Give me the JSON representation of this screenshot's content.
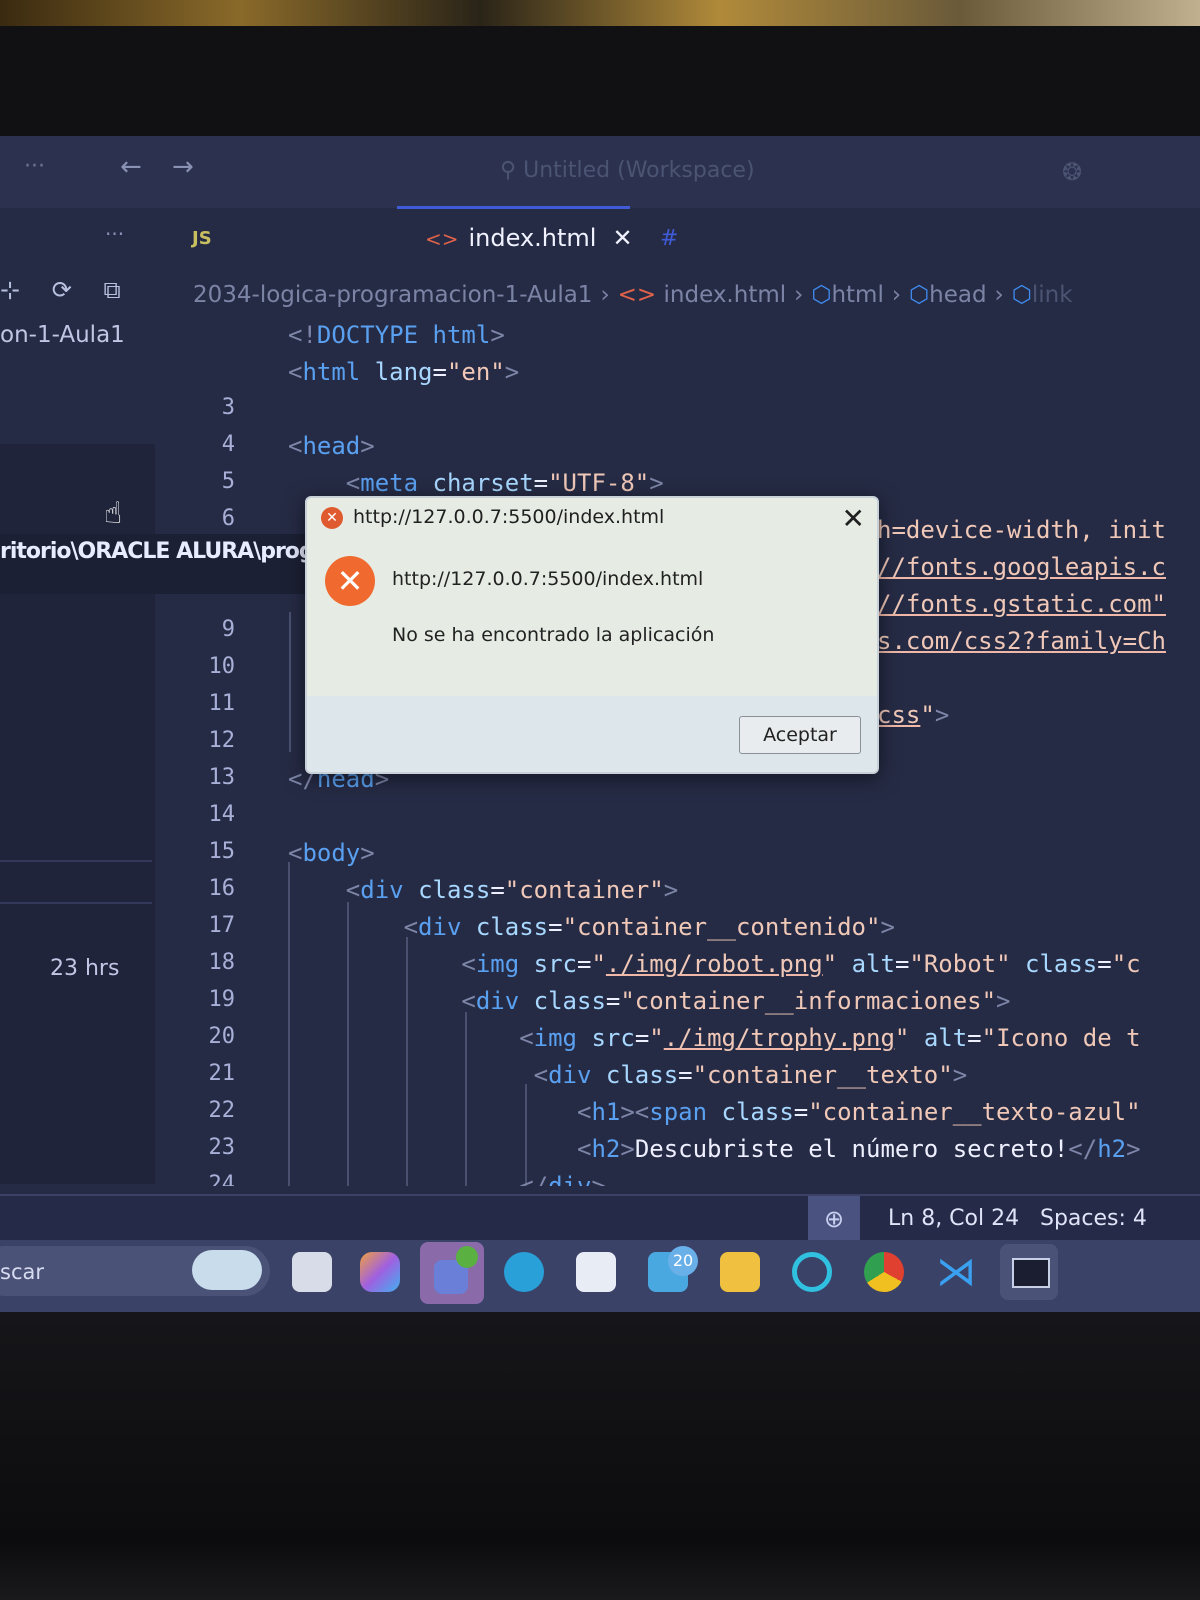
{
  "titlebar": {
    "menu": "···",
    "back": "←",
    "forward": "→",
    "search_icon": "search-icon",
    "search_text": "Untitled (Workspace)",
    "account_icon": "copilot-icon"
  },
  "tabs": {
    "overflow": "···",
    "js_icon": "JS",
    "active": {
      "icon": "<>",
      "label": "index.html",
      "close": "✕"
    },
    "css_icon": "#"
  },
  "sidebar": {
    "toolbar": "⊹ ⟳ ⧉",
    "folder": "on-1-Aula1",
    "hover_path": "ritorio\\ORACLE ALURA\\progra",
    "time": "23 hrs"
  },
  "breadcrumb": {
    "folder": "2034-logica-programacion-1-Aula1",
    "file": "index.html",
    "items": [
      "html",
      "head",
      "link"
    ]
  },
  "editor": {
    "lines": [
      {
        "n": "",
        "indent": 0,
        "tokens": [
          [
            "br",
            "<!"
          ],
          [
            "kw",
            "DOCTYPE"
          ],
          [
            "txt",
            " "
          ],
          [
            "tag",
            "html"
          ],
          [
            "br",
            ">"
          ]
        ]
      },
      {
        "n": "",
        "indent": 0,
        "tokens": [
          [
            "br",
            "<"
          ],
          [
            "tag",
            "html"
          ],
          [
            "txt",
            " "
          ],
          [
            "attr",
            "lang"
          ],
          [
            "txt",
            "="
          ],
          [
            "str",
            "\"en\""
          ],
          [
            "br",
            ">"
          ]
        ]
      },
      {
        "n": "3",
        "indent": 0,
        "tokens": []
      },
      {
        "n": "4",
        "indent": 0,
        "tokens": [
          [
            "br",
            "<"
          ],
          [
            "tag",
            "head"
          ],
          [
            "br",
            ">"
          ]
        ]
      },
      {
        "n": "5",
        "indent": 4,
        "tokens": [
          [
            "br",
            "<"
          ],
          [
            "tag",
            "meta"
          ],
          [
            "txt",
            " "
          ],
          [
            "attr",
            "charset"
          ],
          [
            "txt",
            "="
          ],
          [
            "str",
            "\"UTF-8\""
          ],
          [
            "br",
            ">"
          ]
        ]
      },
      {
        "n": "6",
        "frag": true,
        "tokens": [
          [
            "str",
            "h=device-width, init"
          ]
        ]
      },
      {
        "n": "",
        "frag": true,
        "tokens": [
          [
            "strl",
            "//fonts.googleapis.c"
          ]
        ]
      },
      {
        "n": "",
        "frag": true,
        "tokens": [
          [
            "strl",
            "//fonts.gstatic.com\""
          ]
        ]
      },
      {
        "n": "9",
        "frag": true,
        "tokens": [
          [
            "strl",
            "s.com/css2?family=Ch"
          ]
        ]
      },
      {
        "n": "10",
        "tokens": []
      },
      {
        "n": "11",
        "frag": true,
        "tokens": [
          [
            "strl",
            "css"
          ],
          [
            "str",
            "\""
          ],
          [
            "br",
            ">"
          ]
        ]
      },
      {
        "n": "12",
        "tokens": []
      },
      {
        "n": "13",
        "indent": 0,
        "tokens": [
          [
            "br",
            "</"
          ],
          [
            "tag",
            "head"
          ],
          [
            "br",
            ">"
          ]
        ]
      },
      {
        "n": "14",
        "tokens": []
      },
      {
        "n": "15",
        "indent": 0,
        "tokens": [
          [
            "br",
            "<"
          ],
          [
            "tag",
            "body"
          ],
          [
            "br",
            ">"
          ]
        ]
      },
      {
        "n": "16",
        "indent": 4,
        "tokens": [
          [
            "br",
            "<"
          ],
          [
            "tag",
            "div"
          ],
          [
            "txt",
            " "
          ],
          [
            "attr",
            "class"
          ],
          [
            "txt",
            "="
          ],
          [
            "str",
            "\"container\""
          ],
          [
            "br",
            ">"
          ]
        ]
      },
      {
        "n": "17",
        "indent": 8,
        "tokens": [
          [
            "br",
            "<"
          ],
          [
            "tag",
            "div"
          ],
          [
            "txt",
            " "
          ],
          [
            "attr",
            "class"
          ],
          [
            "txt",
            "="
          ],
          [
            "str",
            "\"container__contenido\""
          ],
          [
            "br",
            ">"
          ]
        ]
      },
      {
        "n": "18",
        "indent": 12,
        "tokens": [
          [
            "br",
            "<"
          ],
          [
            "tag",
            "img"
          ],
          [
            "txt",
            " "
          ],
          [
            "attr",
            "src"
          ],
          [
            "txt",
            "="
          ],
          [
            "str",
            "\""
          ],
          [
            "strl",
            "./img/robot.png"
          ],
          [
            "str",
            "\""
          ],
          [
            "txt",
            " "
          ],
          [
            "attr",
            "alt"
          ],
          [
            "txt",
            "="
          ],
          [
            "str",
            "\"Robot\""
          ],
          [
            "txt",
            " "
          ],
          [
            "attr",
            "class"
          ],
          [
            "txt",
            "="
          ],
          [
            "str",
            "\"c"
          ]
        ]
      },
      {
        "n": "19",
        "indent": 12,
        "tokens": [
          [
            "br",
            "<"
          ],
          [
            "tag",
            "div"
          ],
          [
            "txt",
            " "
          ],
          [
            "attr",
            "class"
          ],
          [
            "txt",
            "="
          ],
          [
            "str",
            "\"container__informaciones\""
          ],
          [
            "br",
            ">"
          ]
        ]
      },
      {
        "n": "20",
        "indent": 16,
        "tokens": [
          [
            "br",
            "<"
          ],
          [
            "tag",
            "img"
          ],
          [
            "txt",
            " "
          ],
          [
            "attr",
            "src"
          ],
          [
            "txt",
            "="
          ],
          [
            "str",
            "\""
          ],
          [
            "strl",
            "./img/trophy.png"
          ],
          [
            "str",
            "\""
          ],
          [
            "txt",
            " "
          ],
          [
            "attr",
            "alt"
          ],
          [
            "txt",
            "="
          ],
          [
            "str",
            "\"Icono de t"
          ]
        ]
      },
      {
        "n": "21",
        "indent": 17,
        "tokens": [
          [
            "br",
            "<"
          ],
          [
            "tag",
            "div"
          ],
          [
            "txt",
            " "
          ],
          [
            "attr",
            "class"
          ],
          [
            "txt",
            "="
          ],
          [
            "str",
            "\"container__texto\""
          ],
          [
            "br",
            ">"
          ]
        ]
      },
      {
        "n": "22",
        "indent": 20,
        "tokens": [
          [
            "br",
            "<"
          ],
          [
            "tag",
            "h1"
          ],
          [
            "br",
            "><"
          ],
          [
            "tag",
            "span"
          ],
          [
            "txt",
            " "
          ],
          [
            "attr",
            "class"
          ],
          [
            "txt",
            "="
          ],
          [
            "str",
            "\"container__texto-azul\""
          ]
        ]
      },
      {
        "n": "23",
        "indent": 20,
        "tokens": [
          [
            "br",
            "<"
          ],
          [
            "tag",
            "h2"
          ],
          [
            "br",
            ">"
          ],
          [
            "txt",
            "Descubriste el número secreto!"
          ],
          [
            "br",
            "</"
          ],
          [
            "tag",
            "h2"
          ],
          [
            "br",
            ">"
          ]
        ]
      },
      {
        "n": "24",
        "indent": 16,
        "tokens": [
          [
            "br",
            "</"
          ],
          [
            "tag",
            "div"
          ],
          [
            "br",
            ">"
          ]
        ]
      }
    ]
  },
  "dialog": {
    "title": "http://127.0.0.7:5500/index.html",
    "close": "✕",
    "icon": "error-icon",
    "url": "http://127.0.0.7:5500/index.html",
    "message": "No se ha encontrado la aplicación",
    "ok_label": "Aceptar"
  },
  "statusbar": {
    "zoom_icon": "zoom-in-icon",
    "position": "Ln 8, Col 24",
    "spaces": "Spaces: 4"
  },
  "taskbar": {
    "search_text": "scar",
    "mail_badge": "20",
    "apps": [
      "widgets-icon",
      "task-view-icon",
      "copilot-icon",
      "teams-icon",
      "edge-icon",
      "store-icon",
      "mail-icon",
      "file-explorer-icon",
      "cortana-icon",
      "chrome-icon",
      "vscode-icon",
      "terminal-icon"
    ]
  },
  "colors": {
    "editor_bg": "#262b45",
    "tag": "#5aa0f0",
    "attribute": "#a8d8ff",
    "string": "#f0c8b8",
    "error": "#f06a30",
    "accent": "#3f5bd8"
  }
}
